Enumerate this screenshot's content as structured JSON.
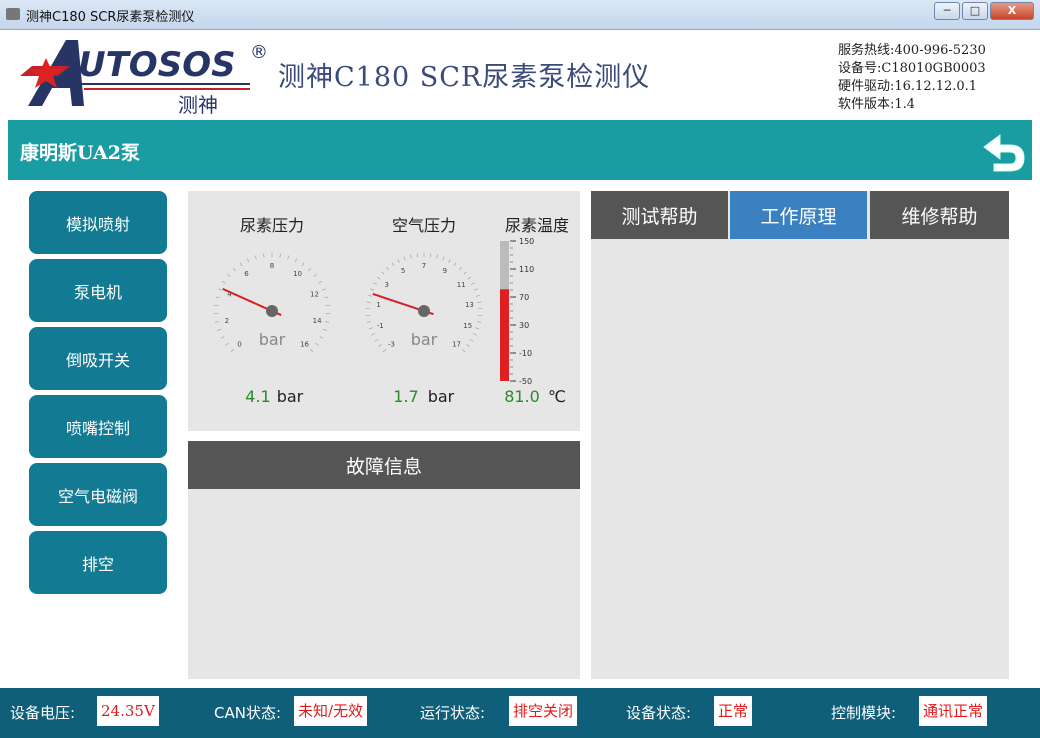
{
  "window": {
    "title": "测神C180 SCR尿素泵检测仪",
    "minimize": "─",
    "maximize": "□",
    "close": "X"
  },
  "header": {
    "logo_text": "UTOSOS",
    "logo_letter": "A",
    "logo_registered": "®",
    "logo_cn": "测神",
    "app_title": "测神C180 SCR尿素泵检测仪",
    "info": [
      "服务热线:400-996-5230",
      "设备号:C18010GB0003",
      "硬件驱动:16.12.12.0.1",
      "软件版本:1.4"
    ]
  },
  "pump": {
    "name": "康明斯UA2泵"
  },
  "icons": {
    "back": "back-arrow-icon"
  },
  "sidebar": {
    "items": [
      {
        "label": "模拟喷射"
      },
      {
        "label": "泵电机"
      },
      {
        "label": "倒吸开关"
      },
      {
        "label": "喷嘴控制"
      },
      {
        "label": "空气电磁阀"
      },
      {
        "label": "排空"
      }
    ]
  },
  "gauges": {
    "urea_pressure": {
      "title": "尿素压力",
      "unit": "bar",
      "value": "4.1",
      "value_unit": "bar",
      "ticks": [
        "0",
        "2",
        "4",
        "6",
        "8",
        "10",
        "12",
        "14",
        "16"
      ],
      "min": 0,
      "max": 16,
      "reading": 4.1
    },
    "air_pressure": {
      "title": "空气压力",
      "unit": "bar",
      "value": "1.7",
      "value_unit": "bar",
      "ticks": [
        "-3",
        "-1",
        "1",
        "3",
        "5",
        "7",
        "9",
        "11",
        "13",
        "15",
        "17"
      ],
      "min": -3,
      "max": 17,
      "reading": 1.7
    },
    "urea_temp": {
      "title": "尿素温度",
      "value": "81.0",
      "value_unit": "℃",
      "ticks": [
        "150",
        "110",
        "70",
        "30",
        "-10",
        "-50"
      ],
      "min": -50,
      "max": 150,
      "reading": 81.0
    }
  },
  "fault": {
    "title": "故障信息"
  },
  "help_tabs": [
    {
      "label": "测试帮助",
      "active": false
    },
    {
      "label": "工作原理",
      "active": true
    },
    {
      "label": "维修帮助",
      "active": false
    }
  ],
  "status": {
    "voltage_label": "设备电压:",
    "voltage_value": "24.35V",
    "can_label": "CAN状态:",
    "can_value": "未知/无效",
    "run_label": "运行状态:",
    "run_value": "排空关闭",
    "device_label": "设备状态:",
    "device_value": "正常",
    "module_label": "控制模块:",
    "module_value": "通讯正常"
  },
  "colors": {
    "teal": "#1a9ca3",
    "sidebar_button": "#127a92",
    "active_tab": "#3b80c0",
    "status_bar": "#0f5f7a",
    "needle": "#d42020",
    "reading_green": "#2a8a2a",
    "alert_red": "#e01a1a"
  }
}
